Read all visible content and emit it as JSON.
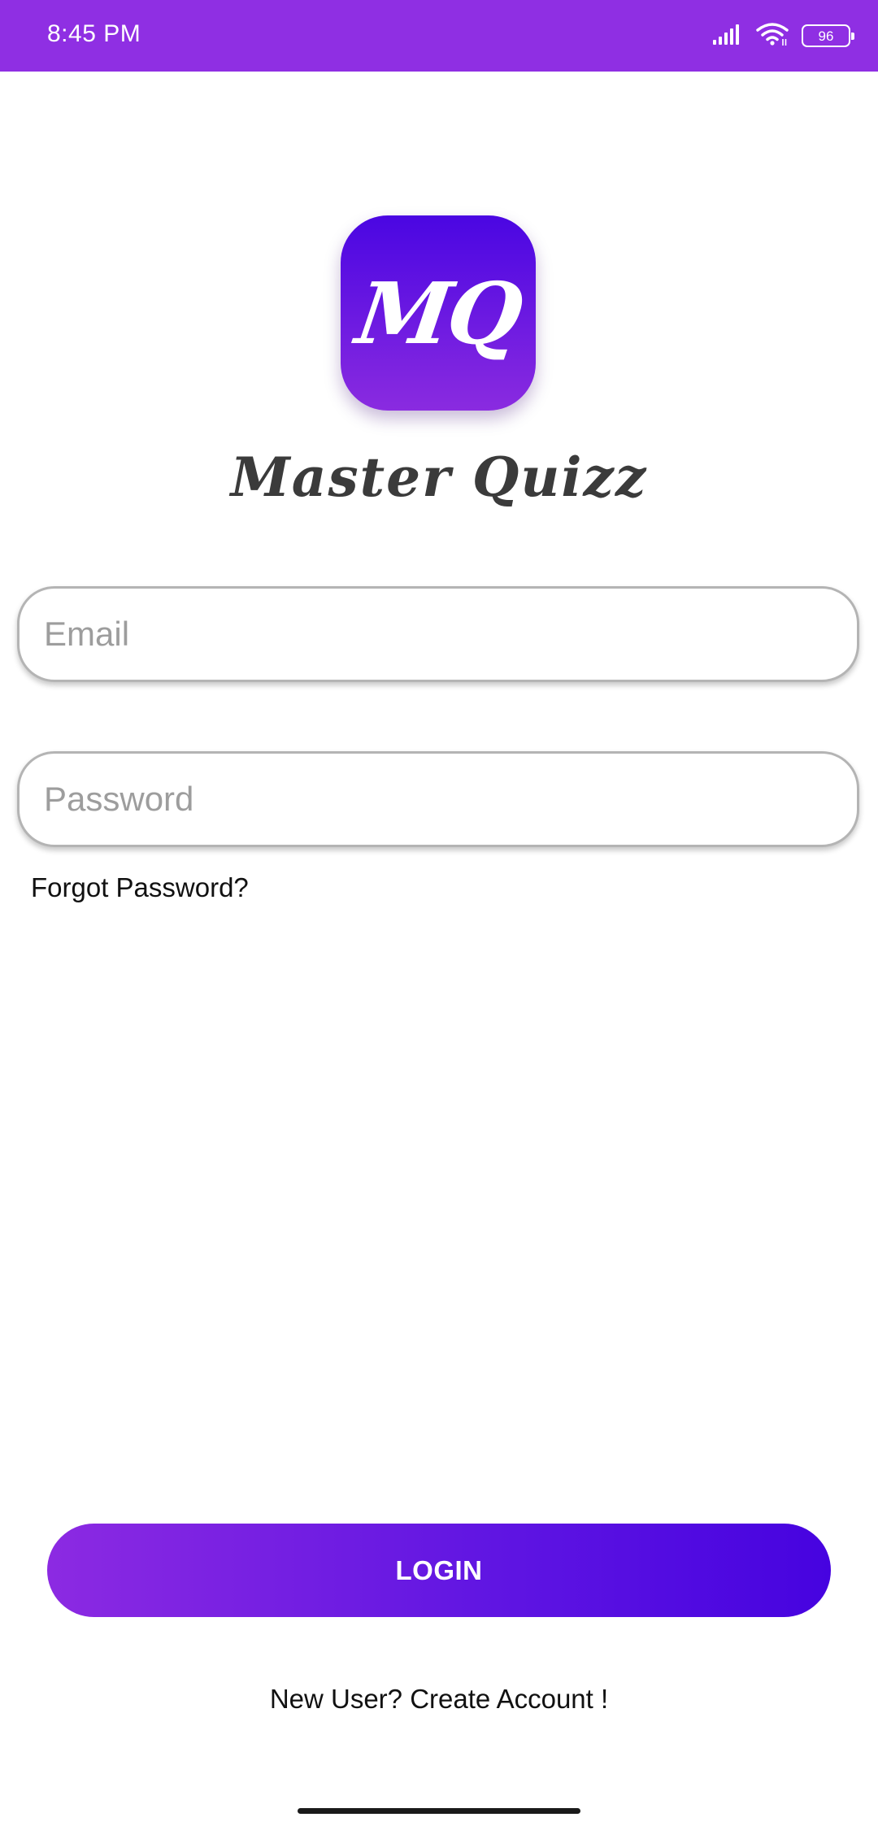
{
  "status_bar": {
    "time": "8:45 PM",
    "battery_level": "96",
    "icons": [
      "cellular-signal-icon",
      "wifi-icon",
      "battery-icon"
    ],
    "background_color": "#8f2fe3"
  },
  "app": {
    "logo_text": "MQ",
    "name": "Master Quizz",
    "accent_gradient": [
      "#8c2ae2",
      "#4603e0"
    ]
  },
  "form": {
    "email_placeholder": "Email",
    "password_placeholder": "Password",
    "forgot_password_label": "Forgot Password?",
    "login_label": "LOGIN",
    "create_account_label": "New User? Create Account !"
  }
}
